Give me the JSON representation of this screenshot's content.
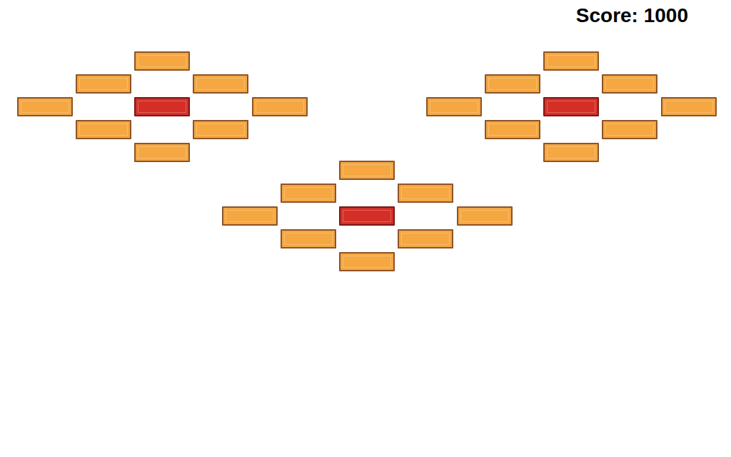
{
  "score": "Score: 1000",
  "clusters": [
    {
      "bricks": [
        {
          "color": "#f5a742"
        },
        {
          "color": "#f5a742"
        },
        {
          "color": "#f5a742"
        },
        {
          "color": "#f5a742"
        },
        {
          "color": "#d42f27"
        },
        {
          "color": "#f5a742"
        },
        {
          "color": "#f5a742"
        },
        {
          "color": "#f5a742"
        },
        {
          "color": "#f5a742"
        }
      ]
    },
    {
      "bricks": [
        {
          "color": "#f5a742"
        },
        {
          "color": "#f5a742"
        },
        {
          "color": "#f5a742"
        },
        {
          "color": "#f5a742"
        },
        {
          "color": "#d42f27"
        },
        {
          "color": "#f5a742"
        },
        {
          "color": "#f5a742"
        },
        {
          "color": "#f5a742"
        },
        {
          "color": "#f5a742"
        }
      ]
    },
    {
      "bricks": [
        {
          "color": "#f5a742"
        },
        {
          "color": "#f5a742"
        },
        {
          "color": "#f5a742"
        },
        {
          "color": "#f5a742"
        },
        {
          "color": "#d42f27"
        },
        {
          "color": "#f5a742"
        },
        {
          "color": "#f5a742"
        },
        {
          "color": "#f5a742"
        },
        {
          "color": "#f5a742"
        }
      ]
    }
  ]
}
